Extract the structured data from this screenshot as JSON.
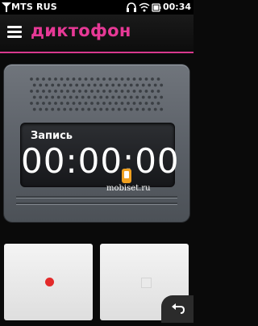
{
  "status_bar": {
    "operator": "MTS RUS",
    "time": "00:34",
    "icons": [
      "signal-icon",
      "headset-icon",
      "wifi-icon",
      "battery-icon"
    ]
  },
  "header": {
    "title": "диктофон",
    "menu_icon": "menu-icon",
    "accent_color": "#e63996"
  },
  "display": {
    "label": "Запись",
    "timer": "00:00:00"
  },
  "watermark": "mobiset.ru",
  "controls": {
    "record_icon": "record-icon",
    "stop_icon": "stop-icon",
    "back_icon": "back-icon",
    "record_color": "#e32a2a"
  }
}
